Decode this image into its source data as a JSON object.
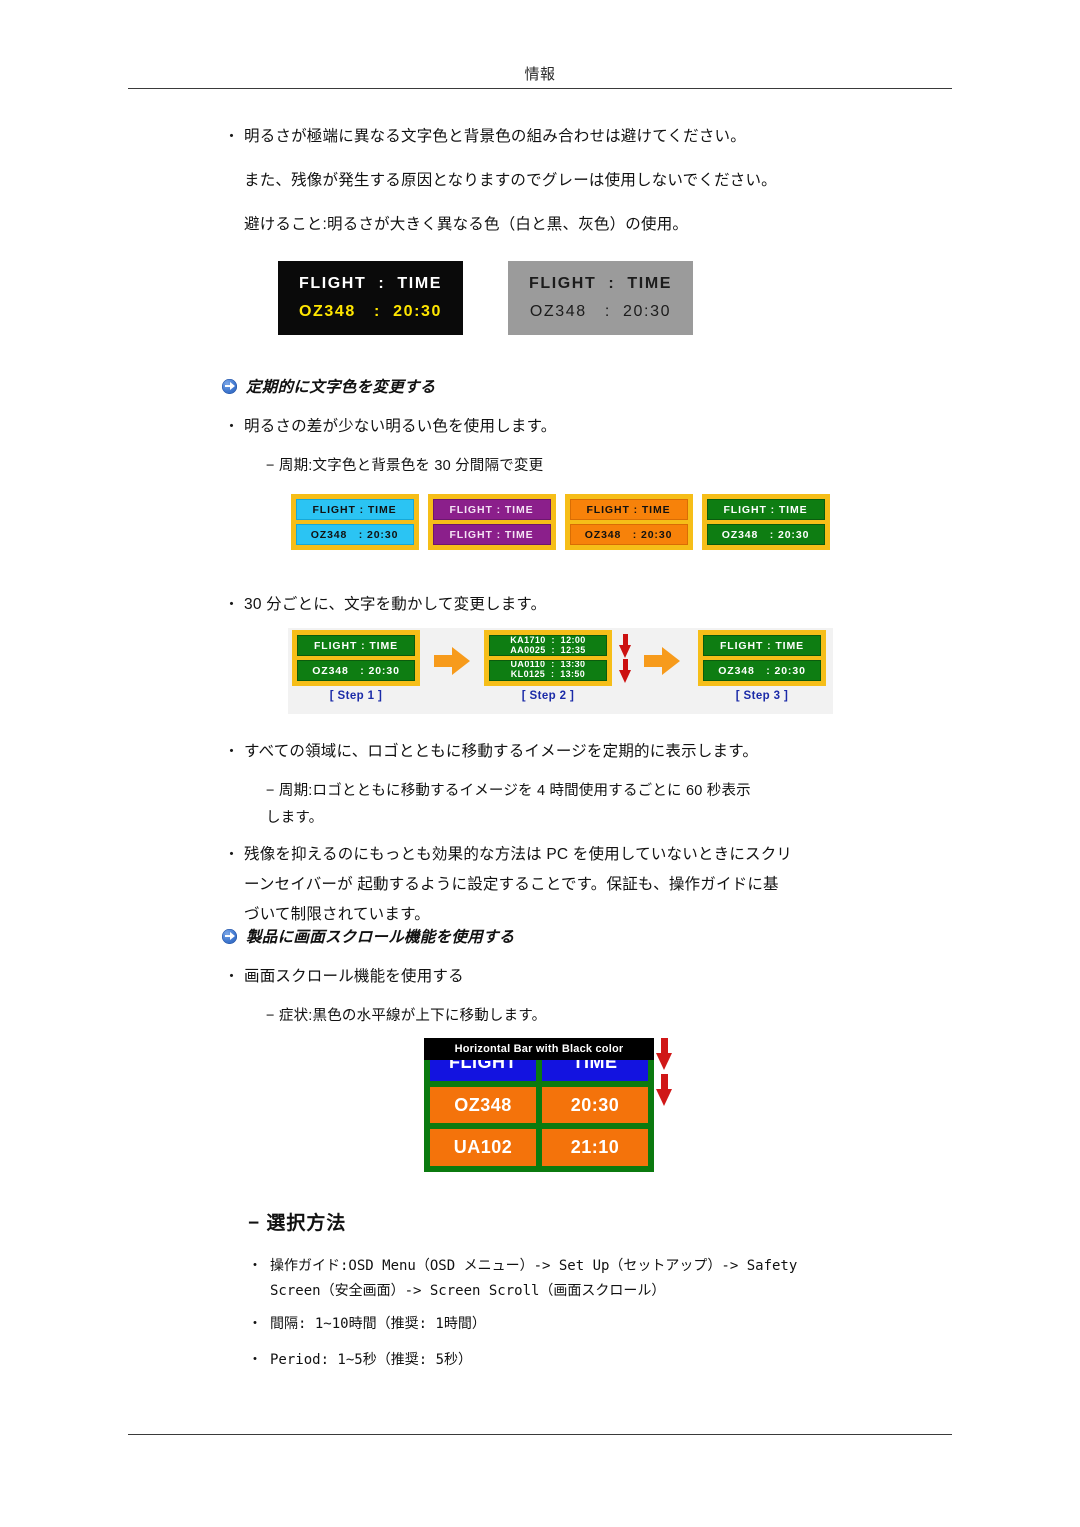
{
  "header": {
    "title": "情報"
  },
  "body": {
    "intro": {
      "bullet": "・",
      "line1": "明るさが極端に異なる文字色と背景色の組み合わせは避けてください。",
      "line2": "また、残像が発生する原因となりますのでグレーは使用しないでください。",
      "line3": "避けること:明るさが大きく異なる色（白と黒、灰色）の使用。"
    },
    "section1": {
      "heading": "定期的に文字色を変更する",
      "bullet1": "明るさの差が少ない明るい色を使用します。",
      "dash1": "− 周期:文字色と背景色を 30 分間隔で変更",
      "bullet2": "30 分ごとに、文字を動かして変更します。",
      "bullet3": "すべての領域に、ロゴとともに移動するイメージを定期的に表示します。",
      "dash2_l1": "− 周期:ロゴとともに移動するイメージを 4 時間使用するごとに 60 秒表示",
      "dash2_l2": "します。",
      "bullet4_l1": "残像を抑えるのにもっとも効果的な方法は PC を使用していないときにスクリ",
      "bullet4_l2": "ーンセイバーが 起動するように設定することです。保証も、操作ガイドに基",
      "bullet4_l3": "づいて制限されています。"
    },
    "section2": {
      "heading": "製品に画面スクロール機能を使用する",
      "bullet1": "画面スクロール機能を使用する",
      "dash1": "− 症状:黒色の水平線が上下に移動します。"
    },
    "selection": {
      "heading": "− 選択方法",
      "items": [
        {
          "bullet": "・",
          "line1": "操作ガイド:OSD Menu（OSD メニュー）-> Set Up（セットアップ）-> Safety",
          "line2": "Screen（安全画面）-> Screen Scroll（画面スクロール）"
        },
        {
          "bullet": "・",
          "line1": "間隔: 1~10時間（推奨: 1時間）",
          "line2": ""
        },
        {
          "bullet": "・",
          "line1": "Period: 1~5秒（推奨: 5秒）",
          "line2": ""
        }
      ]
    }
  },
  "figures": {
    "fig1": {
      "caption_role": "contrast-example",
      "panels": [
        {
          "name": "black-panel",
          "line1": "FLIGHT  :  TIME",
          "line2": "OZ348   :  20:30",
          "bg": "#0a0a0a",
          "line1_color": "#ffffff",
          "line2_color": "#ffe600"
        },
        {
          "name": "gray-panel",
          "line1": "FLIGHT  :  TIME",
          "line2": "OZ348   :  20:30",
          "bg": "#9b9b9b",
          "line1_color": "#1c1c1c",
          "line2_color": "#1c1c1c"
        }
      ]
    },
    "fig2": {
      "caption_role": "color-cycle-example",
      "border_color": "#F6BE18",
      "panels": [
        {
          "name": "cyan-panel",
          "bg": "#2BC4F3",
          "text_color": "#111111",
          "row1": "FLIGHT : TIME",
          "row2": "OZ348   : 20:30"
        },
        {
          "name": "purple-panel",
          "bg": "#8B1F8B",
          "text_color": "#f4e3f4",
          "row1": "FLIGHT : TIME",
          "row2": "FLIGHT : TIME"
        },
        {
          "name": "orange-panel",
          "bg": "#F7820A",
          "text_color": "#111111",
          "row1": "FLIGHT : TIME",
          "row2": "OZ348   : 20:30"
        },
        {
          "name": "green-panel",
          "bg": "#0E7D12",
          "text_color": "#ffffff",
          "row1": "FLIGHT : TIME",
          "row2": "OZ348   : 20:30"
        }
      ]
    },
    "fig3": {
      "caption_role": "scroll-steps",
      "steps": [
        {
          "label": "[ Step 1 ]",
          "row1": "FLIGHT : TIME",
          "row2": "OZ348   : 20:30"
        },
        {
          "label": "[ Step 2 ]",
          "row1_a": "KA1710  :  12:00",
          "row1_b": "AA0025  :  12:35",
          "row2_a": "UA0110  :  13:30",
          "row2_b": "KL0125  :  13:50"
        },
        {
          "label": "[ Step 3 ]",
          "row1": "FLIGHT : TIME",
          "row2": "OZ348   : 20:30"
        }
      ]
    },
    "fig4": {
      "caption_role": "horizontal-bar-demo",
      "bar_label": "Horizontal Bar with Black color",
      "rows": [
        {
          "left": "FLIGHT",
          "right": "TIME",
          "style": "blue"
        },
        {
          "left": "OZ348",
          "right": "20:30",
          "style": "orange"
        },
        {
          "left": "UA102",
          "right": "21:10",
          "style": "orange"
        }
      ],
      "board_bg": "#0B7A0F",
      "arrow_color": "#D01717"
    }
  }
}
